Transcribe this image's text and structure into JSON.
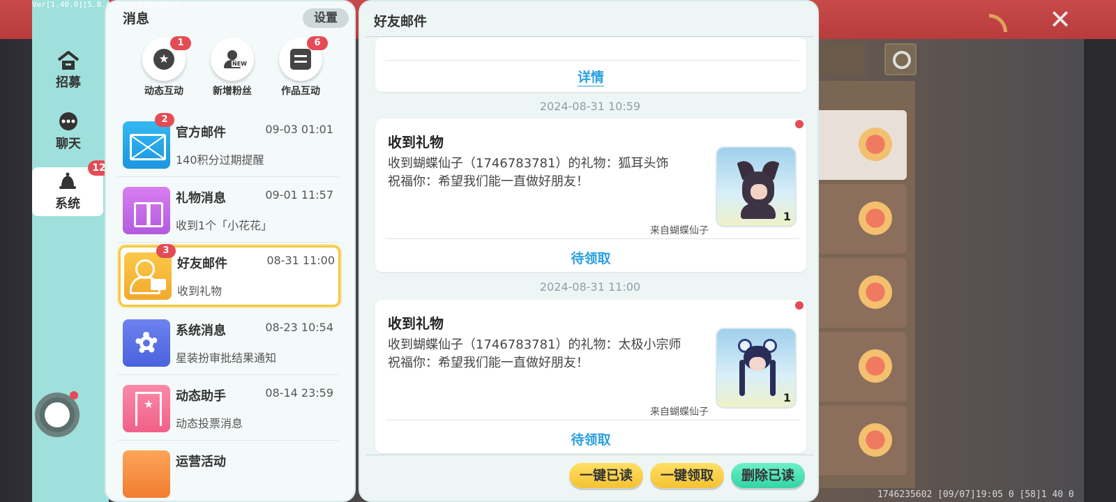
{
  "version_text": "Ver[1.40.0][5.8.4.2]",
  "version_fps": "FPS: 29.9",
  "footer_debug": "1746235602  [09/07]19:05 0  [58]1 40 0",
  "nav": {
    "items": [
      {
        "label": "招募",
        "icon": "house-icon"
      },
      {
        "label": "聊天",
        "icon": "chat-bubble-icon"
      },
      {
        "label": "系统",
        "icon": "bell-icon",
        "badge": "12",
        "active": true
      }
    ]
  },
  "messages_panel": {
    "title": "消息",
    "settings_label": "设置",
    "quick_actions": [
      {
        "label": "动态互动",
        "badge": "1",
        "icon": "star-bubble-icon"
      },
      {
        "label": "新增粉丝",
        "icon": "new-follower-icon",
        "tag": "NEW"
      },
      {
        "label": "作品互动",
        "badge": "6",
        "icon": "document-icon"
      }
    ],
    "items": [
      {
        "name": "官方邮件",
        "time": "09-03 01:01",
        "subtitle": "140积分过期提醒",
        "badge": "2",
        "icon": "envelope-icon"
      },
      {
        "name": "礼物消息",
        "time": "09-01 11:57",
        "subtitle": "收到1个「小花花」",
        "icon": "gift-icon"
      },
      {
        "name": "好友邮件",
        "time": "08-31 11:00",
        "subtitle": "收到礼物",
        "badge": "3",
        "icon": "friend-mail-icon",
        "selected": true
      },
      {
        "name": "系统消息",
        "time": "08-23 10:54",
        "subtitle": "星装扮审批结果通知",
        "icon": "gear-icon"
      },
      {
        "name": "动态助手",
        "time": "08-14 23:59",
        "subtitle": "动态投票消息",
        "icon": "bookmark-star-icon"
      },
      {
        "name": "运营活动",
        "time": "",
        "subtitle": "",
        "icon": "megaphone-icon"
      }
    ]
  },
  "detail_panel": {
    "title": "好友邮件",
    "top_card_action": "详情",
    "mails": [
      {
        "date": "2024-08-31 10:59",
        "title": "收到礼物",
        "line1": "收到蝴蝶仙子（1746783781）的礼物：狐耳头饰",
        "line2": "祝福你：希望我们能一直做好朋友！",
        "from": "来自蝴蝶仙子",
        "qty": "1",
        "action": "待领取",
        "unread": true
      },
      {
        "date": "2024-08-31 11:00",
        "title": "收到礼物",
        "line1": "收到蝴蝶仙子（1746783781）的礼物：太极小宗师",
        "line2": "祝福你：希望我们能一直做好朋友！",
        "from": "来自蝴蝶仙子",
        "qty": "1",
        "action": "待领取",
        "unread": true
      }
    ],
    "buttons": {
      "mark_all_read": "一键已读",
      "claim_all": "一键领取",
      "delete_read": "删除已读"
    }
  },
  "colors": {
    "accent_badge": "#e54b55",
    "link_blue": "#2a9fe0",
    "nav_teal": "#9fe0dc",
    "selected_border": "#f5c843"
  }
}
